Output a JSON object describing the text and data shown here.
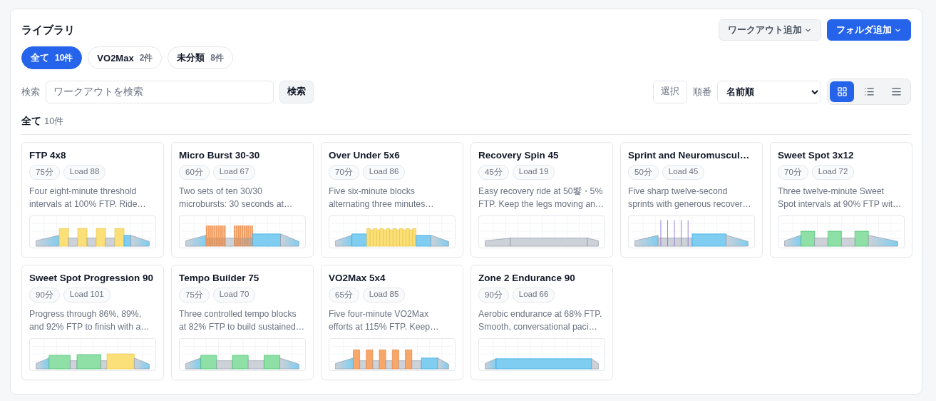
{
  "library": {
    "title": "ライブラリ",
    "actions": [
      {
        "label": "ワークアウト追加",
        "primary": false
      },
      {
        "label": "フォルダ追加",
        "primary": true
      }
    ],
    "filters": [
      {
        "label": "全て",
        "count": "10件",
        "selected": true
      },
      {
        "label": "VO2Max",
        "count": "2件",
        "selected": false
      },
      {
        "label": "未分類",
        "count": "8件",
        "selected": false
      }
    ],
    "search": {
      "label": "検索",
      "placeholder": "ワークアウトを検索",
      "button": "検索"
    },
    "select_button": "選択",
    "sort": {
      "label": "順番",
      "value": "名前順"
    },
    "view_modes": [
      {
        "kind": "grid",
        "selected": true
      },
      {
        "kind": "detail-list",
        "selected": false
      },
      {
        "kind": "list",
        "selected": false
      }
    ],
    "section": {
      "title": "全て",
      "count": "10件"
    },
    "workouts": [
      {
        "title": "FTP 4x8",
        "duration": "75分",
        "load": "Load 88",
        "description_lines": [
          "Four eight-minute threshold",
          "intervals at 100% FTP. Ride…"
        ],
        "kind": "threshold"
      },
      {
        "title": "Micro Burst 30-30",
        "duration": "60分",
        "load": "Load 67",
        "description_lines": [
          "Two sets of ten 30/30",
          "microbursts: 30 seconds at…"
        ],
        "kind": "microburst"
      },
      {
        "title": "Over Under 5x6",
        "duration": "70分",
        "load": "Load 86",
        "description_lines": [
          "Five six-minute blocks",
          "alternating three minutes…"
        ],
        "kind": "overunder"
      },
      {
        "title": "Recovery Spin 45",
        "duration": "45分",
        "load": "Load 19",
        "description_lines": [
          "Easy recovery ride at 50饗・5%",
          "FTP. Keep the legs moving an…"
        ],
        "kind": "recovery"
      },
      {
        "title": "Sprint and Neuromuscul…",
        "duration": "50分",
        "load": "Load 45",
        "description_lines": [
          "Five sharp twelve-second",
          "sprints with generous recover…"
        ],
        "kind": "sprint"
      },
      {
        "title": "Sweet Spot 3x12",
        "duration": "70分",
        "load": "Load 72",
        "description_lines": [
          "Three twelve-minute Sweet",
          "Spot intervals at 90% FTP wit…"
        ],
        "kind": "sweetspot"
      },
      {
        "title": "Sweet Spot Progression 90",
        "duration": "90分",
        "load": "Load 101",
        "description_lines": [
          "Progress through 86%, 89%,",
          "and 92% FTP to finish with a…"
        ],
        "kind": "progression"
      },
      {
        "title": "Tempo Builder 75",
        "duration": "75分",
        "load": "Load 70",
        "description_lines": [
          "Three controlled tempo blocks",
          "at 82% FTP to build sustained…"
        ],
        "kind": "tempo"
      },
      {
        "title": "VO2Max 5x4",
        "duration": "65分",
        "load": "Load 85",
        "description_lines": [
          "Five four-minute VO2Max",
          "efforts at 115% FTP. Keep…"
        ],
        "kind": "vo2max"
      },
      {
        "title": "Zone 2 Endurance 90",
        "duration": "90分",
        "load": "Load 66",
        "description_lines": [
          "Aerobic endurance at 68% FTP.",
          "Smooth, conversational paci…"
        ],
        "kind": "endurance"
      }
    ]
  }
}
